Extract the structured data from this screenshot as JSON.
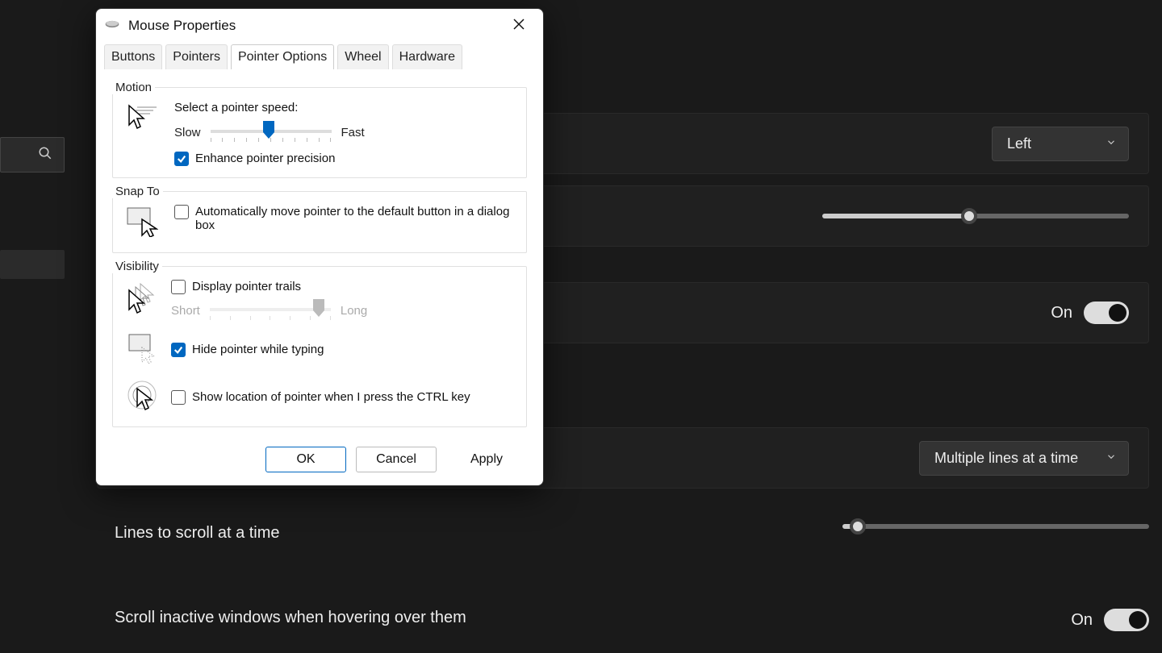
{
  "dialog": {
    "title": "Mouse Properties",
    "tabs": {
      "buttons": "Buttons",
      "pointers": "Pointers",
      "pointer_options": "Pointer Options",
      "wheel": "Wheel",
      "hardware": "Hardware"
    },
    "motion": {
      "group_label": "Motion",
      "speed_label": "Select a pointer speed:",
      "slow": "Slow",
      "fast": "Fast",
      "speed_value_pct": 48,
      "enhance_checked": true,
      "enhance_label": "Enhance pointer precision"
    },
    "snap": {
      "group_label": "Snap To",
      "checked": false,
      "label": "Automatically move pointer to the default button in a dialog box"
    },
    "visibility": {
      "group_label": "Visibility",
      "trails_checked": false,
      "trails_label": "Display pointer trails",
      "trails_short": "Short",
      "trails_long": "Long",
      "trails_value_pct": 90,
      "hide_checked": true,
      "hide_label": "Hide pointer while typing",
      "locate_checked": false,
      "locate_label": "Show location of pointer when I press the CTRL key"
    },
    "footer": {
      "ok": "OK",
      "cancel": "Cancel",
      "apply": "Apply"
    }
  },
  "bg": {
    "primary_button_dropdown": "Left",
    "pointer_speed_slider_pct": 48,
    "enhance_toggle_state": "On",
    "scroll_mode_dropdown": "Multiple lines at a time",
    "lines_label": "Lines to scroll at a time",
    "lines_slider_pct": 5,
    "inactive_label": "Scroll inactive windows when hovering over them",
    "inactive_toggle_state": "On"
  }
}
